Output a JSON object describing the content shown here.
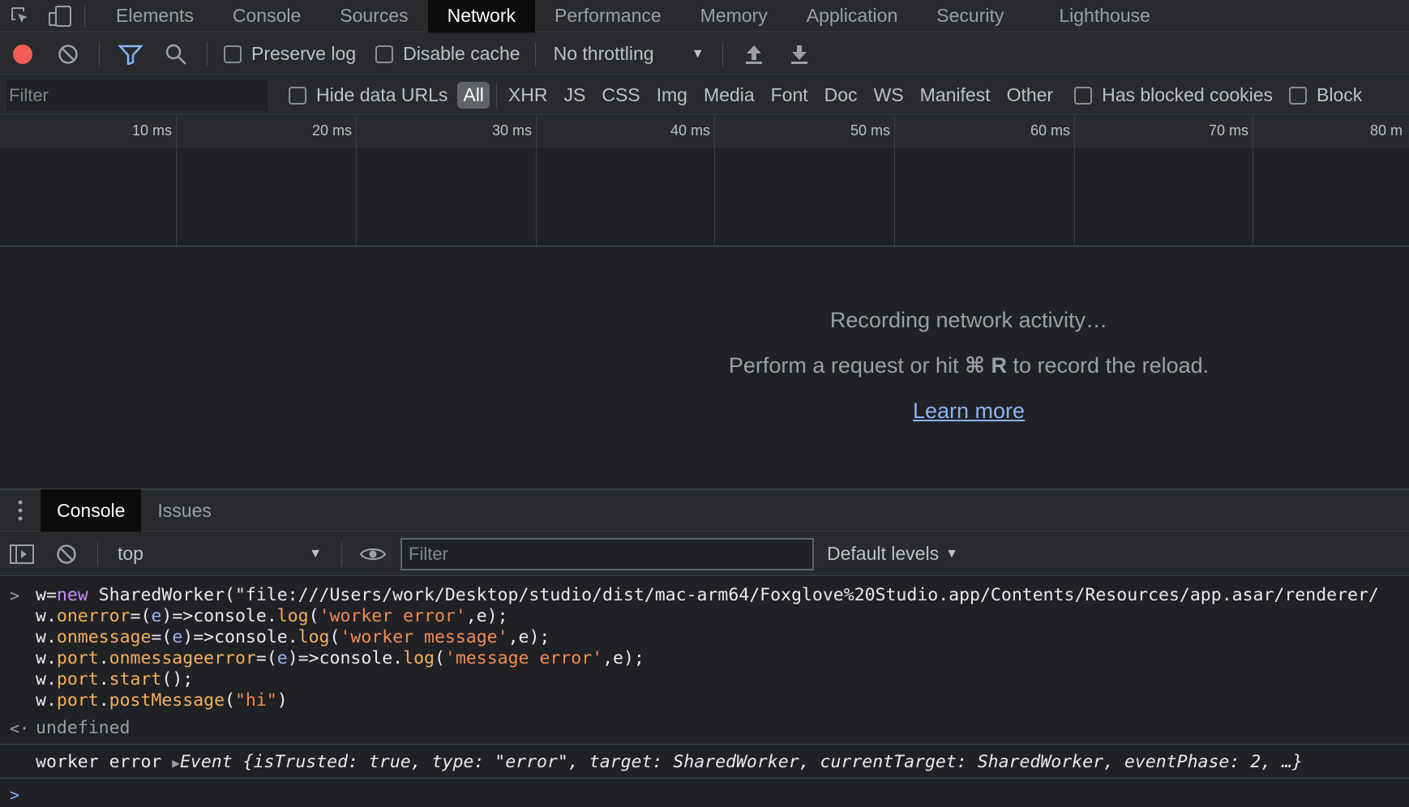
{
  "topbar": {
    "tabs": [
      {
        "label": "Elements"
      },
      {
        "label": "Console"
      },
      {
        "label": "Sources"
      },
      {
        "label": "Network",
        "active": true
      },
      {
        "label": "Performance"
      },
      {
        "label": "Memory"
      },
      {
        "label": "Application"
      },
      {
        "label": "Security"
      },
      {
        "label": "Lighthouse"
      }
    ]
  },
  "toolbar": {
    "preserve_log": "Preserve log",
    "disable_cache": "Disable cache",
    "throttling": "No throttling"
  },
  "filterbar": {
    "filter_placeholder": "Filter",
    "hide_data_urls": "Hide data URLs",
    "types": [
      "All",
      "XHR",
      "JS",
      "CSS",
      "Img",
      "Media",
      "Font",
      "Doc",
      "WS",
      "Manifest",
      "Other"
    ],
    "has_blocked_cookies": "Has blocked cookies",
    "blocked": "Block"
  },
  "timeline": {
    "ticks": [
      "10 ms",
      "20 ms",
      "30 ms",
      "40 ms",
      "50 ms",
      "60 ms",
      "70 ms",
      "80 m"
    ]
  },
  "empty_state": {
    "title": "Recording network activity…",
    "hint_prefix": "Perform a request or hit ",
    "hint_keys": "⌘ R",
    "hint_suffix": " to record the reload.",
    "link": "Learn more"
  },
  "drawer": {
    "tabs": [
      "Console",
      "Issues"
    ],
    "context": "top",
    "filter_placeholder": "Filter",
    "levels": "Default levels"
  },
  "console": {
    "input_lines": [
      "w=new SharedWorker(\"file:///Users/work/Desktop/studio/dist/mac-arm64/Foxglove%20Studio.app/Contents/Resources/app.asar/renderer/",
      "w.onerror=(e)=>console.log('worker error',e);",
      "w.onmessage=(e)=>console.log('worker message',e);",
      "w.port.onmessageerror=(e)=>console.log('message error',e);",
      "w.port.start();",
      "w.port.postMessage(\"hi\")"
    ],
    "result": "undefined",
    "log_prefix": "worker error",
    "log_object": "Event {isTrusted: true, type: \"error\", target: SharedWorker, currentTarget: SharedWorker, eventPhase: 2, …}"
  },
  "colors": {
    "record_red": "#f25c54",
    "filter_blue": "#8ab4f8",
    "link_blue": "#8ab4f8"
  }
}
